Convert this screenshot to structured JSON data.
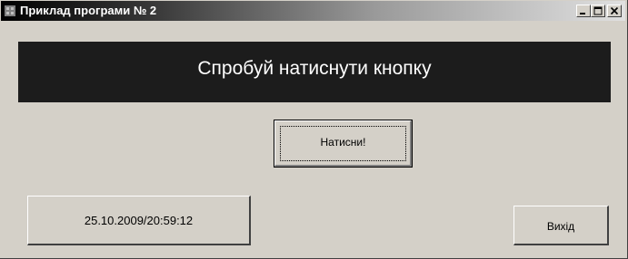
{
  "window": {
    "title": "Приклад програми № 2",
    "controls": [
      "minimize",
      "maximize",
      "close"
    ]
  },
  "banner": {
    "text": "Спробуй натиснути кнопку"
  },
  "main_button": {
    "label": "Натисни!"
  },
  "datetime_panel": {
    "value": "25.10.2009/20:59:12"
  },
  "exit_button": {
    "label": "Вихід"
  }
}
